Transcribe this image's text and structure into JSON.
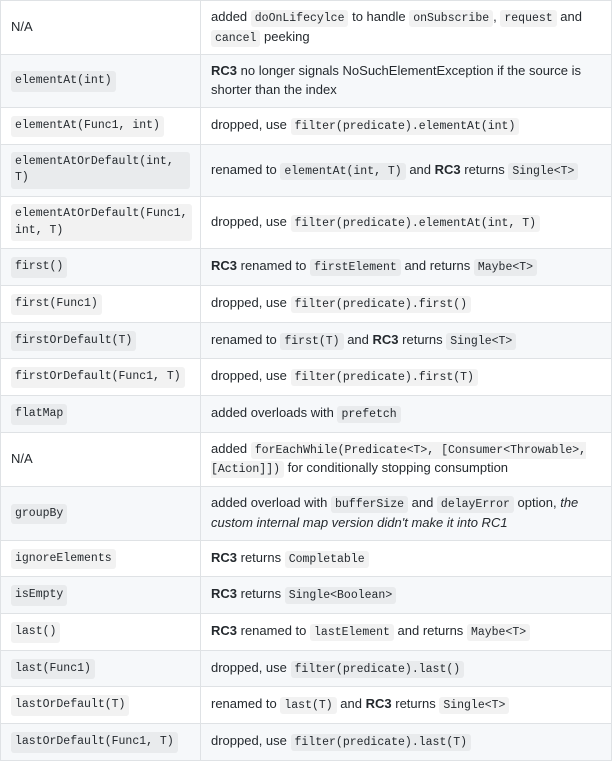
{
  "rows": [
    {
      "left": [
        {
          "t": "text",
          "v": "N/A"
        }
      ],
      "right": [
        {
          "t": "text",
          "v": "added "
        },
        {
          "t": "code",
          "v": "doOnLifecylce"
        },
        {
          "t": "text",
          "v": " to handle "
        },
        {
          "t": "code",
          "v": "onSubscribe"
        },
        {
          "t": "text",
          "v": ", "
        },
        {
          "t": "code",
          "v": "request"
        },
        {
          "t": "text",
          "v": " and "
        },
        {
          "t": "code",
          "v": "cancel"
        },
        {
          "t": "text",
          "v": " peeking"
        }
      ]
    },
    {
      "left": [
        {
          "t": "code",
          "v": "elementAt(int)"
        }
      ],
      "right": [
        {
          "t": "bold",
          "v": "RC3"
        },
        {
          "t": "text",
          "v": " no longer signals NoSuchElementException if the source is shorter than the index"
        }
      ]
    },
    {
      "left": [
        {
          "t": "code",
          "v": "elementAt(Func1, int)"
        }
      ],
      "right": [
        {
          "t": "text",
          "v": "dropped, use "
        },
        {
          "t": "code",
          "v": "filter(predicate).elementAt(int)"
        }
      ]
    },
    {
      "left": [
        {
          "t": "code",
          "v": "elementAtOrDefault(int, T)"
        }
      ],
      "right": [
        {
          "t": "text",
          "v": "renamed to "
        },
        {
          "t": "code",
          "v": "elementAt(int, T)"
        },
        {
          "t": "text",
          "v": " and "
        },
        {
          "t": "bold",
          "v": "RC3"
        },
        {
          "t": "text",
          "v": " returns "
        },
        {
          "t": "code",
          "v": "Single<T>"
        }
      ]
    },
    {
      "left": [
        {
          "t": "code",
          "v": "elementAtOrDefault(Func1, int, T)"
        }
      ],
      "right": [
        {
          "t": "text",
          "v": "dropped, use "
        },
        {
          "t": "code",
          "v": "filter(predicate).elementAt(int, T)"
        }
      ]
    },
    {
      "left": [
        {
          "t": "code",
          "v": "first()"
        }
      ],
      "right": [
        {
          "t": "bold",
          "v": "RC3"
        },
        {
          "t": "text",
          "v": " renamed to "
        },
        {
          "t": "code",
          "v": "firstElement"
        },
        {
          "t": "text",
          "v": " and returns "
        },
        {
          "t": "code",
          "v": "Maybe<T>"
        }
      ]
    },
    {
      "left": [
        {
          "t": "code",
          "v": "first(Func1)"
        }
      ],
      "right": [
        {
          "t": "text",
          "v": "dropped, use "
        },
        {
          "t": "code",
          "v": "filter(predicate).first()"
        }
      ]
    },
    {
      "left": [
        {
          "t": "code",
          "v": "firstOrDefault(T)"
        }
      ],
      "right": [
        {
          "t": "text",
          "v": "renamed to "
        },
        {
          "t": "code",
          "v": "first(T)"
        },
        {
          "t": "text",
          "v": " and "
        },
        {
          "t": "bold",
          "v": "RC3"
        },
        {
          "t": "text",
          "v": " returns "
        },
        {
          "t": "code",
          "v": "Single<T>"
        }
      ]
    },
    {
      "left": [
        {
          "t": "code",
          "v": "firstOrDefault(Func1, T)"
        }
      ],
      "right": [
        {
          "t": "text",
          "v": "dropped, use "
        },
        {
          "t": "code",
          "v": "filter(predicate).first(T)"
        }
      ]
    },
    {
      "left": [
        {
          "t": "code",
          "v": "flatMap"
        }
      ],
      "right": [
        {
          "t": "text",
          "v": "added overloads with "
        },
        {
          "t": "code",
          "v": "prefetch"
        }
      ]
    },
    {
      "left": [
        {
          "t": "text",
          "v": "N/A"
        }
      ],
      "right": [
        {
          "t": "text",
          "v": "added "
        },
        {
          "t": "code",
          "v": "forEachWhile(Predicate<T>, [Consumer<Throwable>, [Action]])"
        },
        {
          "t": "text",
          "v": " for conditionally stopping consumption"
        }
      ]
    },
    {
      "left": [
        {
          "t": "code",
          "v": "groupBy"
        }
      ],
      "right": [
        {
          "t": "text",
          "v": "added overload with "
        },
        {
          "t": "code",
          "v": "bufferSize"
        },
        {
          "t": "text",
          "v": " and "
        },
        {
          "t": "code",
          "v": "delayError"
        },
        {
          "t": "text",
          "v": " option, "
        },
        {
          "t": "italic",
          "v": "the custom internal map version didn't make it into RC1"
        }
      ]
    },
    {
      "left": [
        {
          "t": "code",
          "v": "ignoreElements"
        }
      ],
      "right": [
        {
          "t": "bold",
          "v": "RC3"
        },
        {
          "t": "text",
          "v": " returns "
        },
        {
          "t": "code",
          "v": "Completable"
        }
      ]
    },
    {
      "left": [
        {
          "t": "code",
          "v": "isEmpty"
        }
      ],
      "right": [
        {
          "t": "bold",
          "v": "RC3"
        },
        {
          "t": "text",
          "v": " returns "
        },
        {
          "t": "code",
          "v": "Single<Boolean>"
        }
      ]
    },
    {
      "left": [
        {
          "t": "code",
          "v": "last()"
        }
      ],
      "right": [
        {
          "t": "bold",
          "v": "RC3"
        },
        {
          "t": "text",
          "v": " renamed to "
        },
        {
          "t": "code",
          "v": "lastElement"
        },
        {
          "t": "text",
          "v": " and returns "
        },
        {
          "t": "code",
          "v": "Maybe<T>"
        }
      ]
    },
    {
      "left": [
        {
          "t": "code",
          "v": "last(Func1)"
        }
      ],
      "right": [
        {
          "t": "text",
          "v": "dropped, use "
        },
        {
          "t": "code",
          "v": "filter(predicate).last()"
        }
      ]
    },
    {
      "left": [
        {
          "t": "code",
          "v": "lastOrDefault(T)"
        }
      ],
      "right": [
        {
          "t": "text",
          "v": "renamed to "
        },
        {
          "t": "code",
          "v": "last(T)"
        },
        {
          "t": "text",
          "v": " and "
        },
        {
          "t": "bold",
          "v": "RC3"
        },
        {
          "t": "text",
          "v": " returns "
        },
        {
          "t": "code",
          "v": "Single<T>"
        }
      ]
    },
    {
      "left": [
        {
          "t": "code",
          "v": "lastOrDefault(Func1, T)"
        }
      ],
      "right": [
        {
          "t": "text",
          "v": "dropped, use "
        },
        {
          "t": "code",
          "v": "filter(predicate).last(T)"
        }
      ]
    }
  ]
}
